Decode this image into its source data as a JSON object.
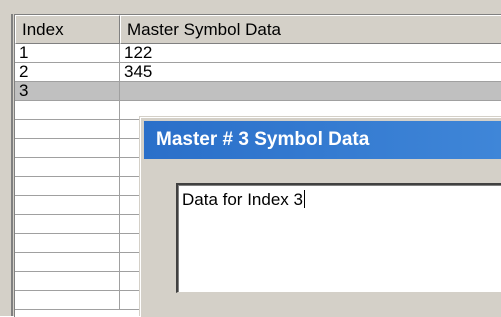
{
  "grid": {
    "headers": {
      "index": "Index",
      "data": "Master Symbol Data"
    },
    "rows": [
      {
        "index": "1",
        "value": "122"
      },
      {
        "index": "2",
        "value": "345"
      },
      {
        "index": "3",
        "value": ""
      },
      {
        "index": "",
        "value": ""
      },
      {
        "index": "",
        "value": ""
      },
      {
        "index": "",
        "value": ""
      },
      {
        "index": "",
        "value": ""
      },
      {
        "index": "",
        "value": ""
      },
      {
        "index": "",
        "value": ""
      },
      {
        "index": "",
        "value": ""
      },
      {
        "index": "",
        "value": ""
      },
      {
        "index": "",
        "value": ""
      },
      {
        "index": "",
        "value": ""
      },
      {
        "index": "",
        "value": ""
      }
    ],
    "selected_row": 2
  },
  "dialog": {
    "title": "Master # 3 Symbol Data",
    "text_value": "Data for Index 3"
  },
  "colors": {
    "titlebar": "#2a6fc9",
    "face": "#d4d0c8",
    "selected_row": "#c0c0c0"
  }
}
